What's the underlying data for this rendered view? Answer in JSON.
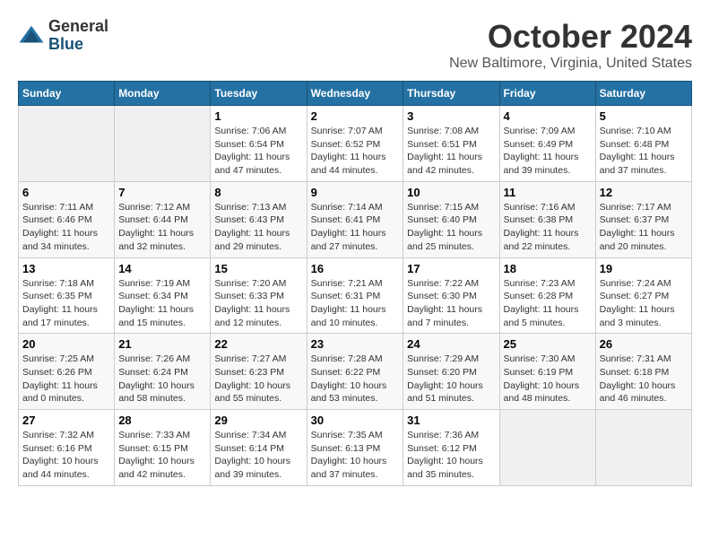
{
  "logo": {
    "general": "General",
    "blue": "Blue"
  },
  "title": "October 2024",
  "location": "New Baltimore, Virginia, United States",
  "days_of_week": [
    "Sunday",
    "Monday",
    "Tuesday",
    "Wednesday",
    "Thursday",
    "Friday",
    "Saturday"
  ],
  "weeks": [
    [
      {
        "day": "",
        "info": ""
      },
      {
        "day": "",
        "info": ""
      },
      {
        "day": "1",
        "info": "Sunrise: 7:06 AM\nSunset: 6:54 PM\nDaylight: 11 hours and 47 minutes."
      },
      {
        "day": "2",
        "info": "Sunrise: 7:07 AM\nSunset: 6:52 PM\nDaylight: 11 hours and 44 minutes."
      },
      {
        "day": "3",
        "info": "Sunrise: 7:08 AM\nSunset: 6:51 PM\nDaylight: 11 hours and 42 minutes."
      },
      {
        "day": "4",
        "info": "Sunrise: 7:09 AM\nSunset: 6:49 PM\nDaylight: 11 hours and 39 minutes."
      },
      {
        "day": "5",
        "info": "Sunrise: 7:10 AM\nSunset: 6:48 PM\nDaylight: 11 hours and 37 minutes."
      }
    ],
    [
      {
        "day": "6",
        "info": "Sunrise: 7:11 AM\nSunset: 6:46 PM\nDaylight: 11 hours and 34 minutes."
      },
      {
        "day": "7",
        "info": "Sunrise: 7:12 AM\nSunset: 6:44 PM\nDaylight: 11 hours and 32 minutes."
      },
      {
        "day": "8",
        "info": "Sunrise: 7:13 AM\nSunset: 6:43 PM\nDaylight: 11 hours and 29 minutes."
      },
      {
        "day": "9",
        "info": "Sunrise: 7:14 AM\nSunset: 6:41 PM\nDaylight: 11 hours and 27 minutes."
      },
      {
        "day": "10",
        "info": "Sunrise: 7:15 AM\nSunset: 6:40 PM\nDaylight: 11 hours and 25 minutes."
      },
      {
        "day": "11",
        "info": "Sunrise: 7:16 AM\nSunset: 6:38 PM\nDaylight: 11 hours and 22 minutes."
      },
      {
        "day": "12",
        "info": "Sunrise: 7:17 AM\nSunset: 6:37 PM\nDaylight: 11 hours and 20 minutes."
      }
    ],
    [
      {
        "day": "13",
        "info": "Sunrise: 7:18 AM\nSunset: 6:35 PM\nDaylight: 11 hours and 17 minutes."
      },
      {
        "day": "14",
        "info": "Sunrise: 7:19 AM\nSunset: 6:34 PM\nDaylight: 11 hours and 15 minutes."
      },
      {
        "day": "15",
        "info": "Sunrise: 7:20 AM\nSunset: 6:33 PM\nDaylight: 11 hours and 12 minutes."
      },
      {
        "day": "16",
        "info": "Sunrise: 7:21 AM\nSunset: 6:31 PM\nDaylight: 11 hours and 10 minutes."
      },
      {
        "day": "17",
        "info": "Sunrise: 7:22 AM\nSunset: 6:30 PM\nDaylight: 11 hours and 7 minutes."
      },
      {
        "day": "18",
        "info": "Sunrise: 7:23 AM\nSunset: 6:28 PM\nDaylight: 11 hours and 5 minutes."
      },
      {
        "day": "19",
        "info": "Sunrise: 7:24 AM\nSunset: 6:27 PM\nDaylight: 11 hours and 3 minutes."
      }
    ],
    [
      {
        "day": "20",
        "info": "Sunrise: 7:25 AM\nSunset: 6:26 PM\nDaylight: 11 hours and 0 minutes."
      },
      {
        "day": "21",
        "info": "Sunrise: 7:26 AM\nSunset: 6:24 PM\nDaylight: 10 hours and 58 minutes."
      },
      {
        "day": "22",
        "info": "Sunrise: 7:27 AM\nSunset: 6:23 PM\nDaylight: 10 hours and 55 minutes."
      },
      {
        "day": "23",
        "info": "Sunrise: 7:28 AM\nSunset: 6:22 PM\nDaylight: 10 hours and 53 minutes."
      },
      {
        "day": "24",
        "info": "Sunrise: 7:29 AM\nSunset: 6:20 PM\nDaylight: 10 hours and 51 minutes."
      },
      {
        "day": "25",
        "info": "Sunrise: 7:30 AM\nSunset: 6:19 PM\nDaylight: 10 hours and 48 minutes."
      },
      {
        "day": "26",
        "info": "Sunrise: 7:31 AM\nSunset: 6:18 PM\nDaylight: 10 hours and 46 minutes."
      }
    ],
    [
      {
        "day": "27",
        "info": "Sunrise: 7:32 AM\nSunset: 6:16 PM\nDaylight: 10 hours and 44 minutes."
      },
      {
        "day": "28",
        "info": "Sunrise: 7:33 AM\nSunset: 6:15 PM\nDaylight: 10 hours and 42 minutes."
      },
      {
        "day": "29",
        "info": "Sunrise: 7:34 AM\nSunset: 6:14 PM\nDaylight: 10 hours and 39 minutes."
      },
      {
        "day": "30",
        "info": "Sunrise: 7:35 AM\nSunset: 6:13 PM\nDaylight: 10 hours and 37 minutes."
      },
      {
        "day": "31",
        "info": "Sunrise: 7:36 AM\nSunset: 6:12 PM\nDaylight: 10 hours and 35 minutes."
      },
      {
        "day": "",
        "info": ""
      },
      {
        "day": "",
        "info": ""
      }
    ]
  ]
}
